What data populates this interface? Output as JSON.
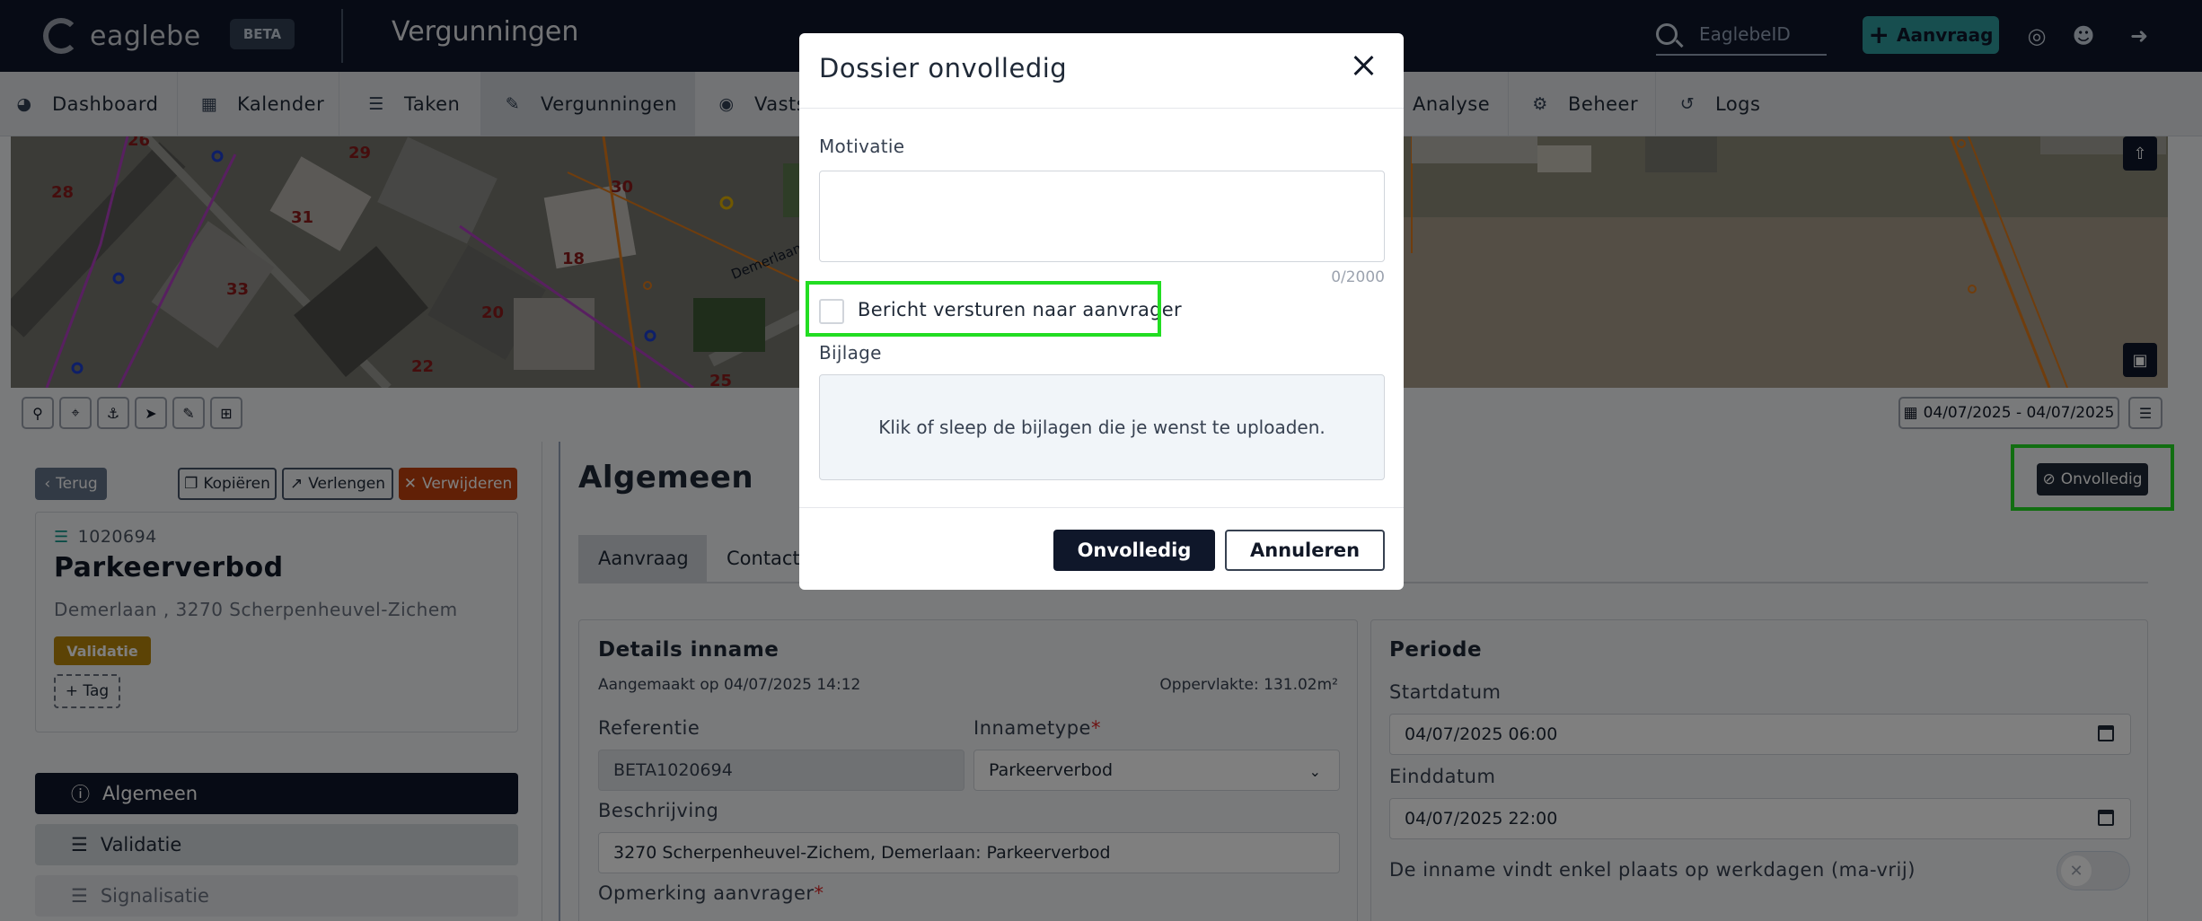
{
  "header": {
    "logo_text": "eaglebe",
    "beta_label": "BETA",
    "app_title": "Vergunningen",
    "search_placeholder": "EaglebeID",
    "new_button_label": "Aanvraag",
    "icons": [
      "search-icon",
      "plus-icon",
      "globe-icon",
      "user-icon",
      "logout-icon"
    ]
  },
  "nav": {
    "items": [
      {
        "label": "Dashboard",
        "icon": "dashboard-icon"
      },
      {
        "label": "Kalender",
        "icon": "calendar-icon"
      },
      {
        "label": "Taken",
        "icon": "tasks-icon"
      },
      {
        "label": "Vergunningen",
        "icon": "permit-icon",
        "active": true
      },
      {
        "label": "Vastst",
        "icon": "eye-icon"
      },
      {
        "label": "Analyse",
        "icon": "chart-icon"
      },
      {
        "label": "Beheer",
        "icon": "gears-icon"
      },
      {
        "label": "Logs",
        "icon": "history-icon"
      }
    ]
  },
  "map": {
    "house_numbers": [
      "26",
      "28",
      "29",
      "30",
      "31",
      "18",
      "33",
      "20",
      "22",
      "25"
    ],
    "street_label": "Demerlaan",
    "date_range": "04/07/2025 - 04/07/2025",
    "tools": [
      "zoom-icon",
      "locate-icon",
      "anchor-icon",
      "pointer-icon",
      "pencil-icon",
      "crop-icon"
    ]
  },
  "record": {
    "back_label": "Terug",
    "copy_label": "Kopiëren",
    "extend_label": "Verlengen",
    "delete_label": "Verwijderen",
    "id": "1020694",
    "title": "Parkeerverbod",
    "address": "Demerlaan , 3270 Scherpenheuvel-Zichem",
    "status_badge": "Validatie",
    "tag_button": "+ Tag",
    "side_nav": [
      {
        "label": "Algemeen",
        "icon": "info-icon",
        "state": "active"
      },
      {
        "label": "Validatie",
        "icon": "checklist-icon",
        "state": "normal"
      },
      {
        "label": "Signalisatie",
        "icon": "sign-icon",
        "state": "dim"
      }
    ]
  },
  "main": {
    "title": "Algemeen",
    "status_button": "Onvolledig",
    "tabs": [
      "Aanvraag",
      "Contact"
    ],
    "details": {
      "title": "Details inname",
      "created": "Aangemaakt op 04/07/2025 14:12",
      "area": "Oppervlakte: 131.02m²",
      "ref_label": "Referentie",
      "ref_value": "BETA1020694",
      "type_label": "Innametype",
      "type_value": "Parkeerverbod",
      "desc_label": "Beschrijving",
      "desc_value": "3270 Scherpenheuvel-Zichem, Demerlaan: Parkeerverbod",
      "remark_label": "Opmerking aanvrager"
    },
    "period": {
      "title": "Periode",
      "start_label": "Startdatum",
      "start_value": "04/07/2025 06:00",
      "end_label": "Einddatum",
      "end_value": "04/07/2025 22:00",
      "weekdays_label": "De inname vindt enkel plaats op werkdagen (ma-vrij)",
      "weekdays_on": false
    }
  },
  "modal": {
    "title": "Dossier onvolledig",
    "motivation_label": "Motivatie",
    "counter": "0/2000",
    "checkbox_label": "Bericht versturen naar aanvrager",
    "checkbox_checked": false,
    "attachment_label": "Bijlage",
    "dropzone_text": "Klik of sleep de bijlagen die je wenst te uploaden.",
    "confirm_label": "Onvolledig",
    "cancel_label": "Annuleren"
  },
  "colors": {
    "topbar": "#0f172a",
    "accent": "#2f9c9f",
    "danger": "#c2410c",
    "badge": "#b8860b",
    "highlight": "#22dd22"
  }
}
